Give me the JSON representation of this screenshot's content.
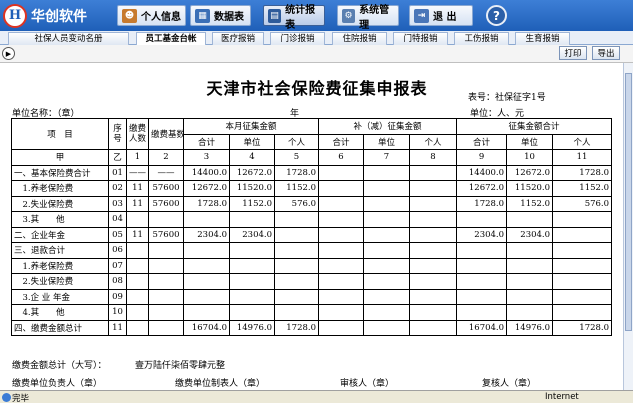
{
  "app": {
    "logo_mark": "H",
    "logo_text": "华创软件"
  },
  "nav": {
    "personal": "个人信息",
    "data": "数据表",
    "stats": "统计报表",
    "system": "系统管理",
    "exit": "退 出",
    "help": "?"
  },
  "tabs": [
    "社保人员变动名册",
    "员工基金台帐",
    "医疗报销",
    "门诊报销",
    "住院报销",
    "门特报销",
    "工伤报销",
    "生育报销"
  ],
  "toolbar": {
    "print": "打印",
    "export": "导出",
    "expand": "▶"
  },
  "report": {
    "title": "天津市社会保险费征集申报表",
    "form_no": "表号：社保征字1号",
    "unit_name": "单位名称：（章）",
    "year": "年",
    "unit": "单位：人、元"
  },
  "headers": {
    "item": "项　目",
    "seq": "序号",
    "persons": "缴费人数",
    "base": "缴费基数",
    "month": "本月征集金额",
    "supplement": "补（减）征集金额",
    "total": "征集金额合计",
    "sum": "合计",
    "unit_pay": "单位",
    "individual": "个人"
  },
  "index_row": [
    "甲",
    "乙",
    "1",
    "2",
    "3",
    "4",
    "5",
    "6",
    "7",
    "8",
    "9",
    "10",
    "11"
  ],
  "rows": [
    [
      "一、基本保险费合计",
      "01",
      "——",
      "——",
      "14400.0",
      "12672.0",
      "1728.0",
      "",
      "",
      "",
      "14400.0",
      "12672.0",
      "1728.0"
    ],
    [
      "　1.养老保险费",
      "02",
      "11",
      "57600",
      "12672.0",
      "11520.0",
      "1152.0",
      "",
      "",
      "",
      "12672.0",
      "11520.0",
      "1152.0"
    ],
    [
      "　2.失业保险费",
      "03",
      "11",
      "57600",
      "1728.0",
      "1152.0",
      "576.0",
      "",
      "",
      "",
      "1728.0",
      "1152.0",
      "576.0"
    ],
    [
      "　3.其　　他",
      "04",
      "",
      "",
      "",
      "",
      "",
      "",
      "",
      "",
      "",
      "",
      ""
    ],
    [
      "二、企业年金",
      "05",
      "11",
      "57600",
      "2304.0",
      "2304.0",
      "",
      "",
      "",
      "",
      "2304.0",
      "2304.0",
      ""
    ],
    [
      "三、退款合计",
      "06",
      "",
      "",
      "",
      "",
      "",
      "",
      "",
      "",
      "",
      "",
      ""
    ],
    [
      "　1.养老保险费",
      "07",
      "",
      "",
      "",
      "",
      "",
      "",
      "",
      "",
      "",
      "",
      ""
    ],
    [
      "　2.失业保险费",
      "08",
      "",
      "",
      "",
      "",
      "",
      "",
      "",
      "",
      "",
      "",
      ""
    ],
    [
      "　3.企 业 年金",
      "09",
      "",
      "",
      "",
      "",
      "",
      "",
      "",
      "",
      "",
      "",
      ""
    ],
    [
      "　4.其　　他",
      "10",
      "",
      "",
      "",
      "",
      "",
      "",
      "",
      "",
      "",
      "",
      ""
    ],
    [
      "四、缴费金额总计",
      "11",
      "",
      "",
      "16704.0",
      "14976.0",
      "1728.0",
      "",
      "",
      "",
      "16704.0",
      "14976.0",
      "1728.0"
    ]
  ],
  "total_words_label": "缴费金额总计（大写）：",
  "total_words": "壹万陆仟柒佰零肆元整",
  "sign": {
    "owner": "缴费单位负责人（章）",
    "maker": "缴费单位制表人（章）",
    "auditor": "审核人（章）",
    "reviewer": "复核人（章）"
  },
  "status": {
    "done": "完毕",
    "zone": "Internet"
  },
  "colors": {
    "header": "#1f5fb8",
    "accent": "#d32f2f"
  }
}
